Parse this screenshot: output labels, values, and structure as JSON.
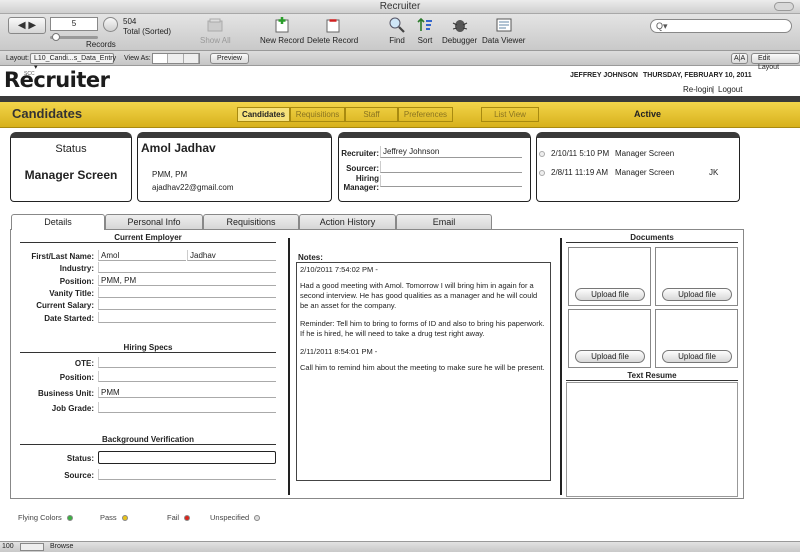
{
  "window": {
    "title": "Recruiter"
  },
  "toolbar": {
    "record_number": "5",
    "record_total": "504",
    "record_sort": "Total (Sorted)",
    "records_label": "Records",
    "show_all": "Show All",
    "new_record": "New Record",
    "delete_record": "Delete Record",
    "find": "Find",
    "sort": "Sort",
    "debugger": "Debugger",
    "data_viewer": "Data Viewer",
    "search_glyph": "Q▾"
  },
  "layoutbar": {
    "layout_label": "Layout:",
    "layout_value": "L10_Candi...s_Data_Entry ▾",
    "view_as_label": "View As:",
    "preview": "Preview",
    "text_size": "A|A",
    "edit_layout": "Edit Layout"
  },
  "header": {
    "logo": "Recruiter",
    "logo_prefix": "R",
    "logo_sub": "SCC",
    "user": "JEFFREY JOHNSON",
    "date": "THURSDAY, FEBRUARY 10, 2011",
    "relogin": "Re-login",
    "separator": "|",
    "logout": "Logout"
  },
  "banner": {
    "title": "Candidates",
    "tabs": [
      "Candidates",
      "Requisitions",
      "Staff",
      "Preferences"
    ],
    "list_view": "List View",
    "status": "Active"
  },
  "status_card": {
    "label": "Status",
    "value": "Manager Screen"
  },
  "candidate": {
    "name": "Amol Jadhav",
    "title": "PMM, PM",
    "email": "ajadhav22@gmail.com"
  },
  "recruiter_card": {
    "recruiter_label": "Recruiter:",
    "recruiter_value": "Jeffrey Johnson",
    "sourcer_label": "Sourcer:",
    "sourcer_value": "",
    "hiring_label_1": "Hiring",
    "hiring_label_2": "Manager:",
    "hiring_value": ""
  },
  "history": [
    {
      "date": "2/10/11 5:10 PM",
      "status": "Manager Screen",
      "initials": ""
    },
    {
      "date": "2/8/11 11:19 AM",
      "status": "Manager Screen",
      "initials": "JK"
    }
  ],
  "subtabs": [
    "Details",
    "Personal Info",
    "Requisitions",
    "Action History",
    "Email"
  ],
  "current_employer": {
    "title": "Current Employer",
    "first_last_label": "First/Last Name:",
    "first": "Amol",
    "last": "Jadhav",
    "industry_label": "Industry:",
    "industry": "",
    "position_label": "Position:",
    "position": "PMM, PM",
    "vanity_label": "Vanity Title:",
    "vanity": "",
    "salary_label": "Current Salary:",
    "salary": "",
    "started_label": "Date Started:",
    "started": ""
  },
  "hiring_specs": {
    "title": "Hiring Specs",
    "ote_label": "OTE:",
    "ote": "",
    "position_label": "Position:",
    "position": "",
    "bu_label": "Business Unit:",
    "bu": "PMM",
    "grade_label": "Job Grade:",
    "grade": ""
  },
  "background": {
    "title": "Background Verification",
    "status_label": "Status:",
    "status": "",
    "source_label": "Source:",
    "source": ""
  },
  "notes": {
    "label": "Notes:",
    "entry1_header": "2/10/2011  7:54:02 PM -",
    "entry1_p1": "Had a good meeting with Amol. Tomorrow I will bring him in again for a second interview. He has good qualities as a manager and he will could be an asset for the company.",
    "entry1_p2": "Reminder: Tell him to bring to forms of ID and also to bring his paperwork. If he is hired, he will need to take a drug test right away.",
    "entry2_header": "2/11/2011  8:54:01 PM -",
    "entry2_p1": "Call him to remind him about the meeting to make sure he will be present."
  },
  "documents": {
    "title": "Documents",
    "upload": "Upload file",
    "resume_title": "Text Resume"
  },
  "legend": {
    "flying": "Flying Colors",
    "pass": "Pass",
    "fail": "Fail",
    "unspecified": "Unspecified",
    "colors": {
      "flying": "#3cb043",
      "pass": "#e8c21a",
      "fail": "#d9261c",
      "unspecified": "#dddddd"
    }
  },
  "statusbar": {
    "zoom": "100",
    "mode": "Browse"
  }
}
